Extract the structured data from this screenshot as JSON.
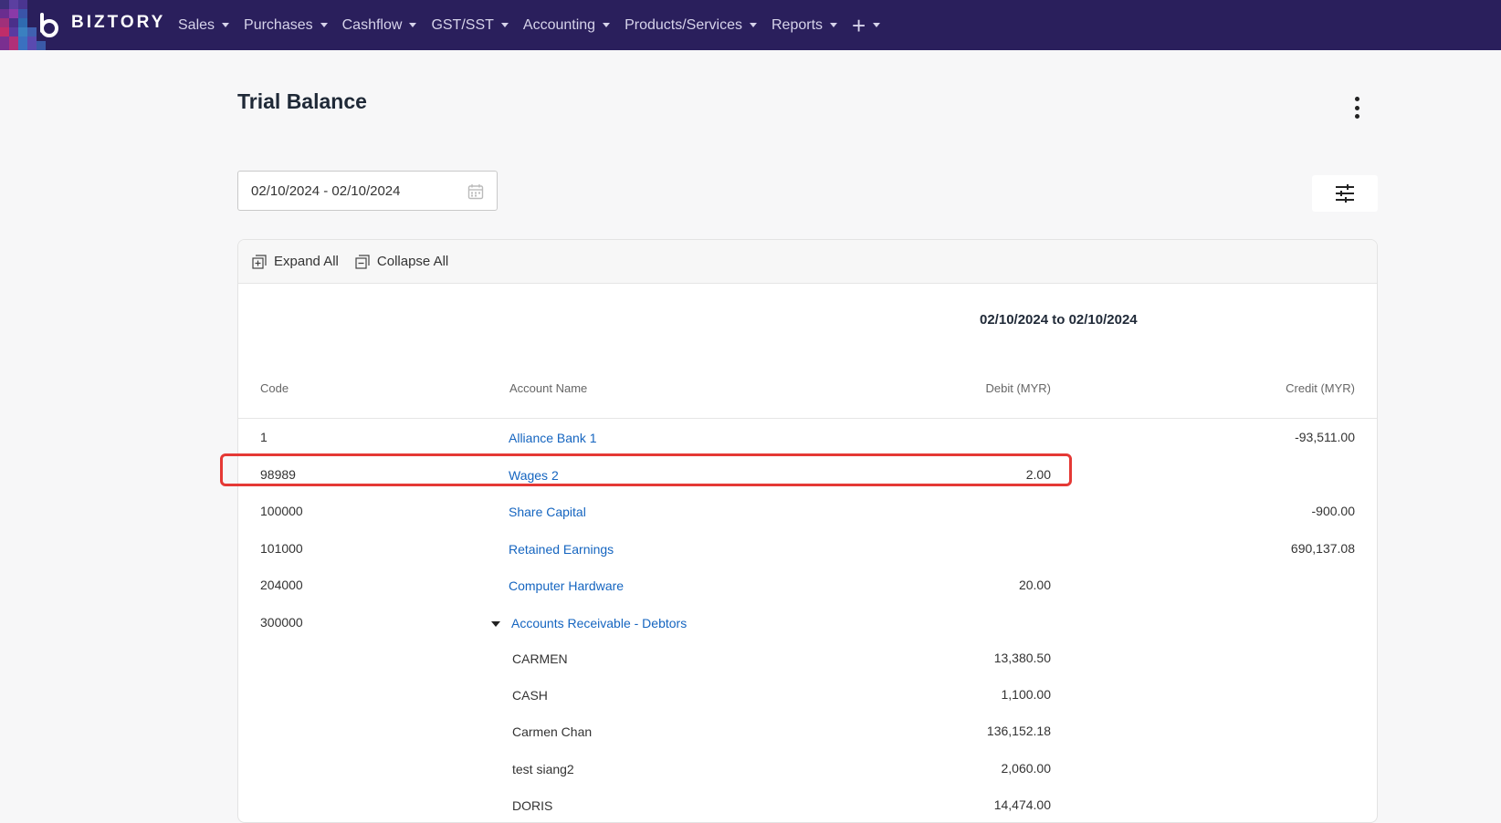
{
  "brand": {
    "name": "BIZTORY"
  },
  "nav": {
    "items": [
      {
        "label": "Sales"
      },
      {
        "label": "Purchases"
      },
      {
        "label": "Cashflow"
      },
      {
        "label": "GST/SST"
      },
      {
        "label": "Accounting"
      },
      {
        "label": "Products/Services"
      },
      {
        "label": "Reports"
      }
    ],
    "add_icon": "plus-icon"
  },
  "page": {
    "title": "Trial Balance",
    "date_range_value": "02/10/2024 - 02/10/2024"
  },
  "toolbar": {
    "expand_label": "Expand All",
    "collapse_label": "Collapse All"
  },
  "report": {
    "period": "02/10/2024 to 02/10/2024",
    "columns": {
      "code": "Code",
      "account_name": "Account Name",
      "debit": "Debit (MYR)",
      "credit": "Credit (MYR)"
    },
    "rows": [
      {
        "code": "1",
        "name": "Alliance Bank 1",
        "debit": "",
        "credit": "-93,511.00"
      },
      {
        "code": "98989",
        "name": "Wages 2",
        "debit": "2.00",
        "credit": ""
      },
      {
        "code": "100000",
        "name": "Share Capital",
        "debit": "",
        "credit": "-900.00"
      },
      {
        "code": "101000",
        "name": "Retained Earnings",
        "debit": "",
        "credit": "690,137.08"
      },
      {
        "code": "204000",
        "name": "Computer Hardware",
        "debit": "20.00",
        "credit": ""
      },
      {
        "code": "300000",
        "name": "Accounts Receivable - Debtors",
        "debit": "",
        "credit": "",
        "expanded": true
      }
    ],
    "sub_rows": [
      {
        "name": "CARMEN",
        "debit": "13,380.50"
      },
      {
        "name": "CASH",
        "debit": "1,100.00"
      },
      {
        "name": "Carmen Chan",
        "debit": "136,152.18"
      },
      {
        "name": "test siang2",
        "debit": "2,060.00"
      },
      {
        "name": "DORIS",
        "debit": "14,474.00"
      }
    ]
  },
  "colors": {
    "nav_bg": "#2a1f5c",
    "link": "#1565c0",
    "highlight": "#e53935"
  }
}
